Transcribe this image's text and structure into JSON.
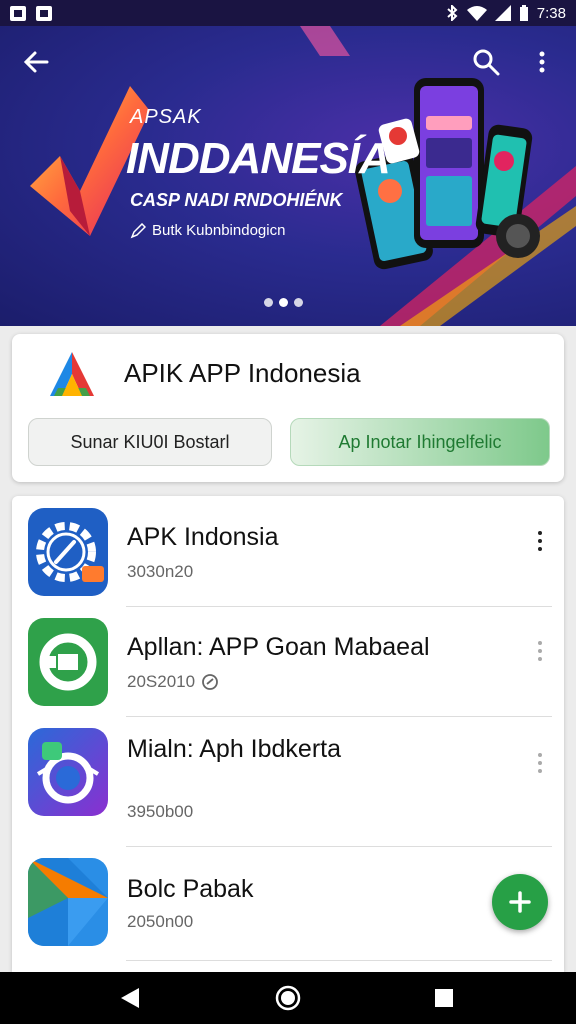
{
  "status_bar": {
    "time": "7:38",
    "icons": [
      "image-icon",
      "notification-icon",
      "bluetooth-icon",
      "wifi-icon",
      "signal-icon",
      "battery-icon"
    ]
  },
  "hero": {
    "brand": "APSAK",
    "title": "INDDANESÍA",
    "subtitle": "CASP NADI RNDOHIÉNK",
    "tagline": "Butk Kubnbindogicn",
    "slides_total": 3,
    "active_slide": 1,
    "icons": [
      "back-arrow-icon",
      "search-icon",
      "more-vert-icon"
    ]
  },
  "featured": {
    "title": "APIK APP Indonesia",
    "button_left": "Sunar KIU0I Bostarl",
    "button_right": "Ap Inotar Ihingelfelic"
  },
  "apps": [
    {
      "name": "APK Indonsia",
      "meta": "3030n20",
      "icon": "gear-gauge-icon"
    },
    {
      "name": "Apllan: APP Goan Mabaeal",
      "meta": "20S2010",
      "icon": "green-plug-icon"
    },
    {
      "name": "Mialn: Aph Ibdkerta",
      "meta": "3950b00",
      "icon": "purple-robot-icon"
    },
    {
      "name": "Bolc Pabak",
      "meta": "2050n00",
      "icon": "play-triangle-icon"
    }
  ],
  "colors": {
    "status_bar": "#1a1442",
    "hero_bg": "#2a2b8f",
    "fab": "#27a046",
    "accent_green": "#1f7a32"
  }
}
